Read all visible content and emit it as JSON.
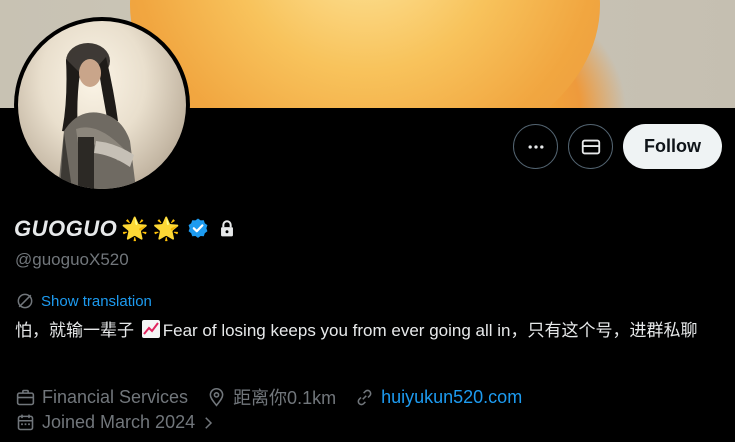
{
  "profile": {
    "display_name": "GUOGUO",
    "name_emojis": [
      "🌟",
      "🌟"
    ],
    "handle": "@guoguoX520",
    "verified": true,
    "protected": true
  },
  "actions": {
    "more_icon": "more-horizontal-icon",
    "message_icon": "envelope-icon",
    "follow_label": "Follow"
  },
  "translation": {
    "label": "Show translation",
    "icon": "translate-globe-icon"
  },
  "bio": {
    "before_emoji": "怕，就输一辈子 ",
    "after_emoji": "Fear of losing keeps you from ever going all in，只有这个号，进群私聊"
  },
  "meta": {
    "category": "Financial Services",
    "location": "距离你0.1km",
    "website": "huiyukun520.com",
    "joined": "Joined March 2024"
  },
  "colors": {
    "accent": "#1d9bf0",
    "muted": "#71767b",
    "text": "#e7e9ea",
    "background": "#000000"
  }
}
